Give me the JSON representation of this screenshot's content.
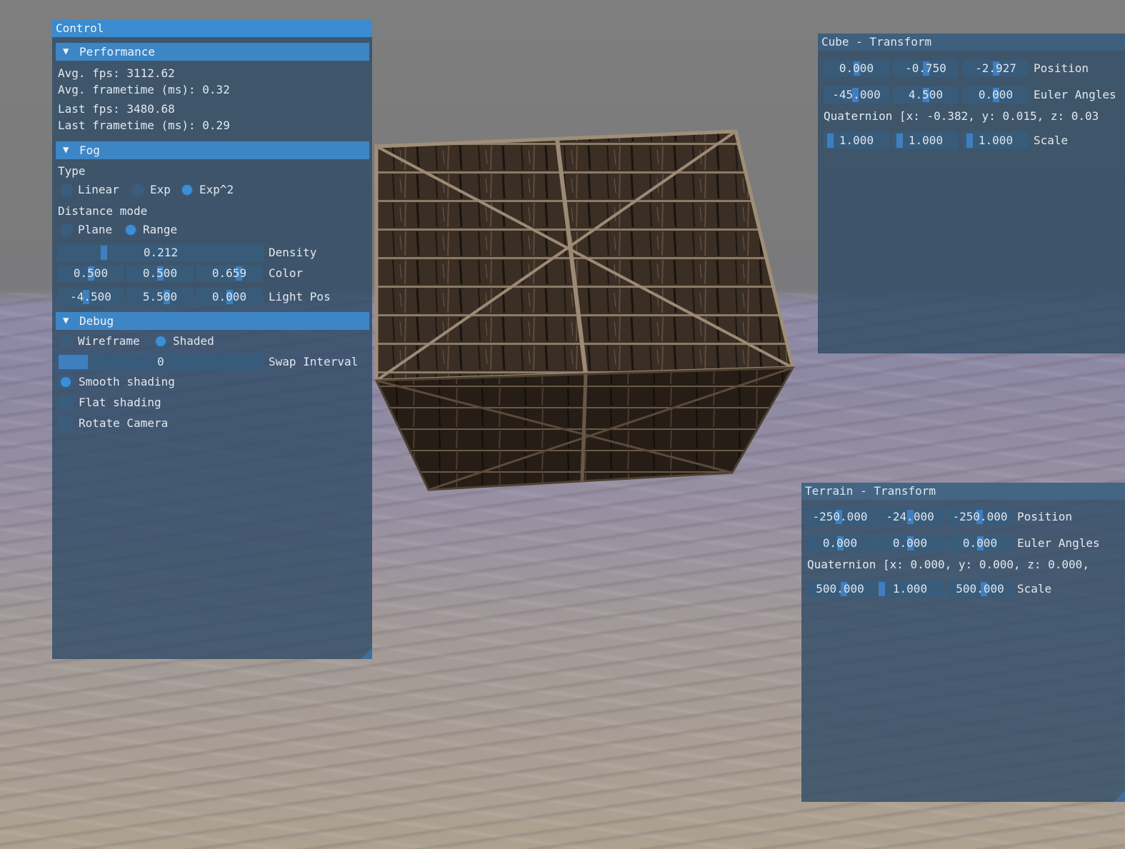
{
  "control": {
    "title": "Control",
    "performance": {
      "header": "Performance",
      "avg_fps": "Avg. fps: 3112.62",
      "avg_frametime": "Avg. frametime (ms): 0.32",
      "last_fps": "Last fps: 3480.68",
      "last_frametime": "Last frametime (ms): 0.29"
    },
    "fog": {
      "header": "Fog",
      "type_label": "Type",
      "type_options": [
        "Linear",
        "Exp",
        "Exp^2"
      ],
      "type_selected": "Exp^2",
      "distance_label": "Distance mode",
      "distance_options": [
        "Plane",
        "Range"
      ],
      "distance_selected": "Range",
      "density_value": "0.212",
      "density_fraction": 0.212,
      "density_label": "Density",
      "color_values": [
        "0.500",
        "0.500",
        "0.659"
      ],
      "color_label": "Color",
      "light_pos_values": [
        "-4.500",
        "5.500",
        "0.000"
      ],
      "light_pos_label": "Light Pos"
    },
    "debug": {
      "header": "Debug",
      "render_options": [
        "Wireframe",
        "Shaded"
      ],
      "render_selected": "Shaded",
      "swap_value": "0",
      "swap_label": "Swap Interval",
      "smooth_shading": "Smooth shading",
      "flat_shading": "Flat shading",
      "rotate_camera": "Rotate Camera",
      "smooth_checked": true,
      "flat_checked": false,
      "rotate_checked": false
    }
  },
  "cube_transform": {
    "title": "Cube - Transform",
    "position": [
      "0.000",
      "-0.750",
      "-2.927"
    ],
    "position_label": "Position",
    "euler": [
      "-45.000",
      "4.500",
      "0.000"
    ],
    "euler_label": "Euler Angles",
    "quaternion": "Quaternion [x: -0.382, y: 0.015, z: 0.03",
    "scale": [
      "1.000",
      "1.000",
      "1.000"
    ],
    "scale_label": "Scale"
  },
  "terrain_transform": {
    "title": "Terrain - Transform",
    "position": [
      "-250.000",
      "-24.000",
      "-250.000"
    ],
    "position_label": "Position",
    "euler": [
      "0.000",
      "0.000",
      "0.000"
    ],
    "euler_label": "Euler Angles",
    "quaternion": "Quaternion [x: 0.000, y: 0.000, z: 0.000,",
    "scale": [
      "500.000",
      "1.000",
      "500.000"
    ],
    "scale_label": "Scale"
  },
  "colors": {
    "accent": "#3a8bd0",
    "panel": "#2e4b65",
    "sky": "#7e7e7e",
    "sand": "#ada190",
    "crate": "#3a2e24"
  }
}
